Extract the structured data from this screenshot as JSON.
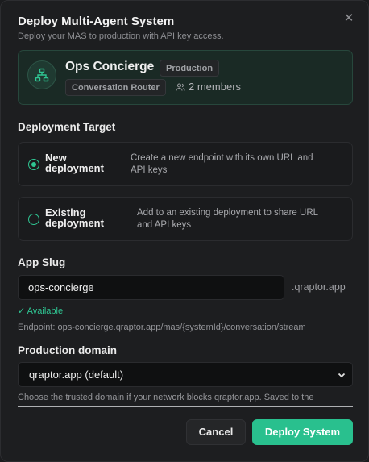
{
  "dialog": {
    "title": "Deploy Multi-Agent System",
    "subtitle": "Deploy your MAS to production with API key access.",
    "close_icon": "close-icon"
  },
  "system": {
    "name": "Ops Concierge",
    "environment_badge": "Production",
    "type_badge": "Conversation Router",
    "members": "2 members",
    "icon": "hierarchy-icon",
    "accent_color": "#2fc592"
  },
  "deployment_target": {
    "label": "Deployment Target",
    "options": [
      {
        "label_line1": "New",
        "label_line2": "deployment",
        "desc_line1": "Create a new endpoint with its own URL and",
        "desc_line2": "API keys",
        "selected": true
      },
      {
        "label_line1": "Existing",
        "label_line2": "deployment",
        "desc_line1": "Add to an existing deployment to share URL",
        "desc_line2": "and API keys",
        "selected": false
      }
    ]
  },
  "app_slug": {
    "label": "App Slug",
    "value": "ops-concierge",
    "suffix": ".qraptor.app",
    "status": "✓ Available",
    "endpoint": "Endpoint: ops-concierge.qraptor.app/mas/{systemId}/conversation/stream"
  },
  "production_domain": {
    "label": "Production domain",
    "selected": "qraptor.app (default)",
    "help": "Choose the trusted domain if your network blocks qraptor.app. Saved to the"
  },
  "actions": {
    "cancel": "Cancel",
    "deploy": "Deploy System"
  }
}
